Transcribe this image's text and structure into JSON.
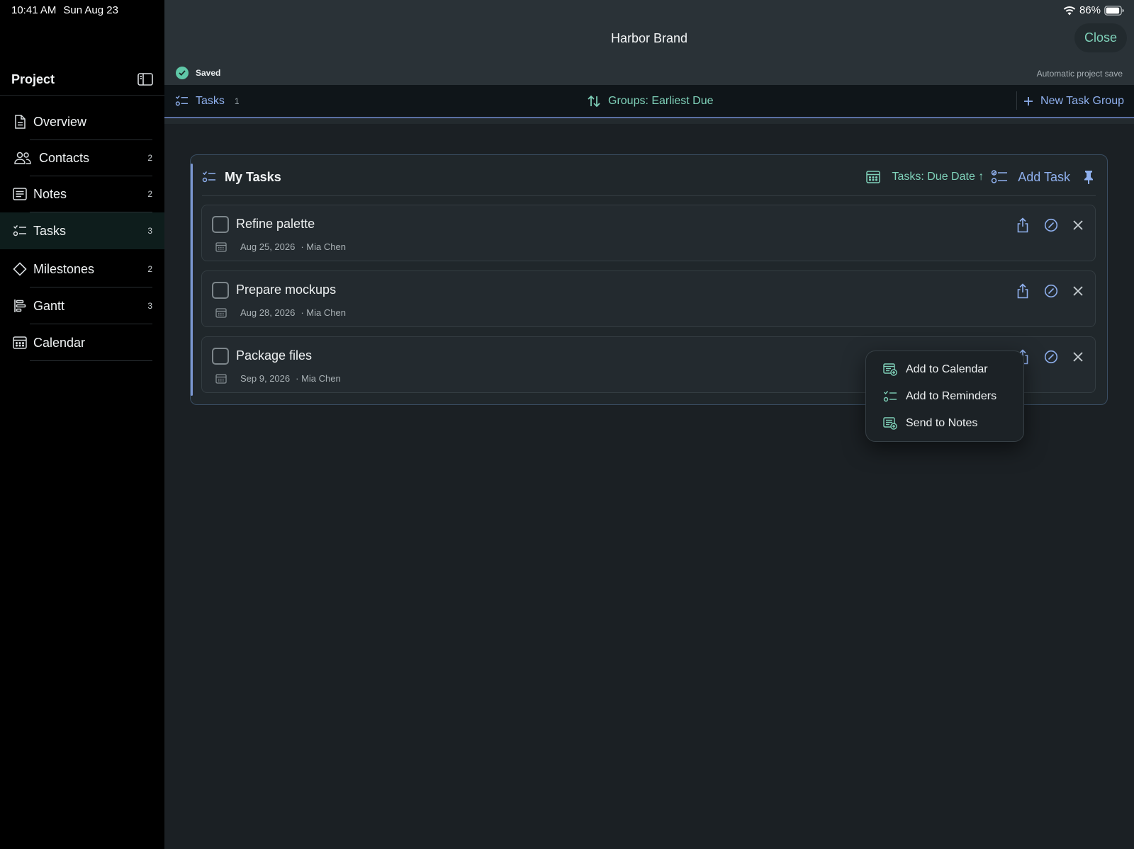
{
  "status_bar": {
    "time": "10:41 AM",
    "date": "Sun Aug 23",
    "battery": "86%"
  },
  "colors": {
    "accent_teal": "#7fd1b9",
    "accent_blue": "#8fb0ee",
    "saved_green": "#5fc7a7"
  },
  "sidebar": {
    "title": "Project",
    "items": [
      {
        "label": "Overview",
        "count": "",
        "icon": "document-icon"
      },
      {
        "label": "Contacts",
        "count": "2",
        "icon": "people-icon"
      },
      {
        "label": "Notes",
        "count": "2",
        "icon": "notes-icon"
      },
      {
        "label": "Tasks",
        "count": "3",
        "icon": "checklist-icon",
        "active": true
      },
      {
        "label": "Milestones",
        "count": "2",
        "icon": "diamond-icon"
      },
      {
        "label": "Gantt",
        "count": "3",
        "icon": "gantt-icon"
      },
      {
        "label": "Calendar",
        "count": "",
        "icon": "calendar-icon"
      }
    ]
  },
  "header": {
    "title": "Harbor Brand",
    "close_label": "Close",
    "saved_label": "Saved",
    "autosave_label": "Automatic project save"
  },
  "toolbar": {
    "tasks_label": "Tasks",
    "tasks_count": "1",
    "groups_label": "Groups: Earliest Due",
    "new_group_label": "New Task Group"
  },
  "group": {
    "title": "My Tasks",
    "sort_label": "Tasks: Due Date ↑",
    "add_task_label": "Add Task",
    "tasks": [
      {
        "name": "Refine palette",
        "date": "Aug 25, 2026",
        "assignee": "· Mia Chen"
      },
      {
        "name": "Prepare mockups",
        "date": "Aug 28, 2026",
        "assignee": "· Mia Chen"
      },
      {
        "name": "Package files",
        "date": "Sep 9, 2026",
        "assignee": "· Mia Chen"
      }
    ]
  },
  "share_menu": {
    "items": [
      {
        "label": "Add to Calendar",
        "icon": "calendar-add-icon"
      },
      {
        "label": "Add to Reminders",
        "icon": "reminders-icon"
      },
      {
        "label": "Send to Notes",
        "icon": "notes-add-icon"
      }
    ]
  }
}
